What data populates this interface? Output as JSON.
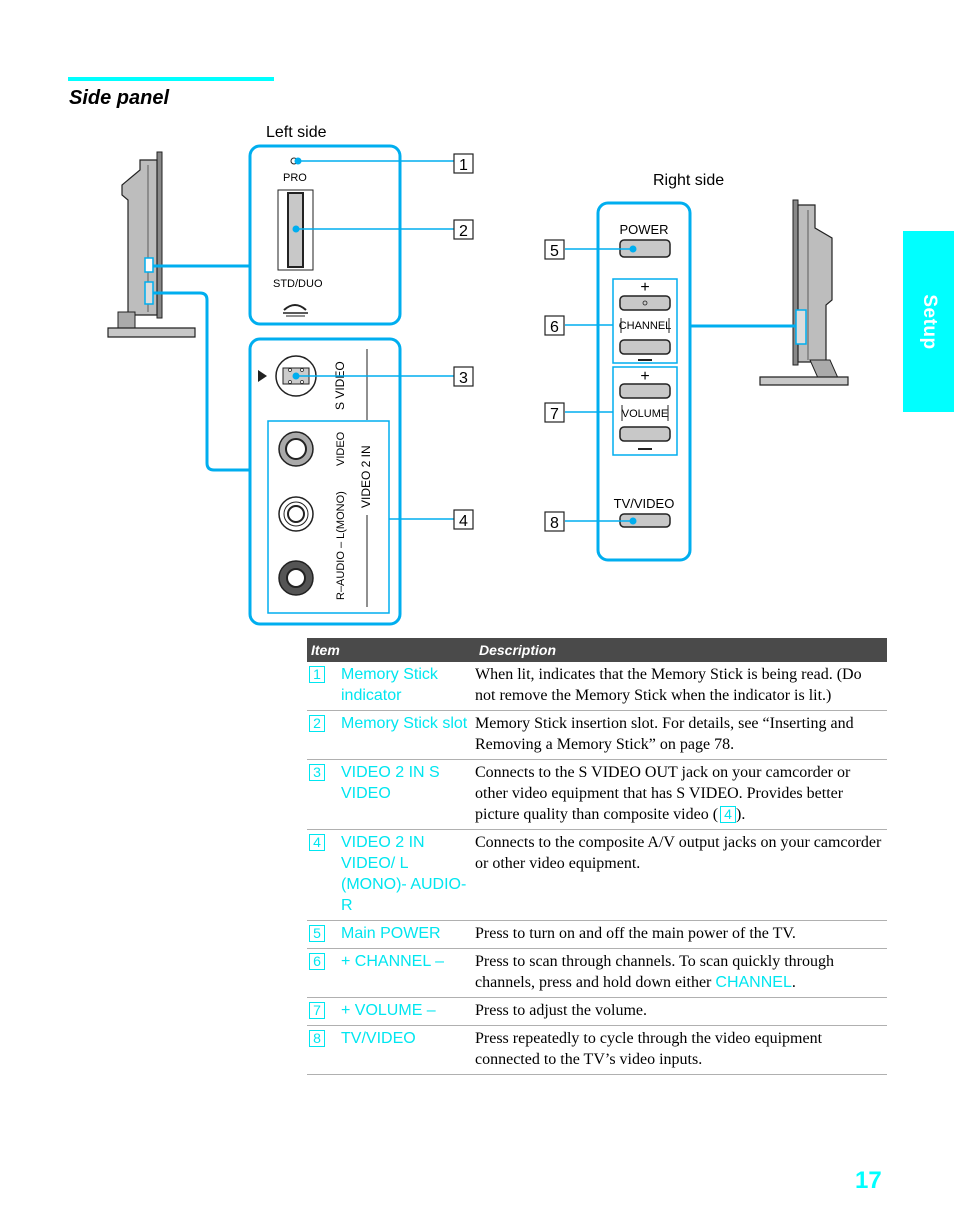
{
  "section_title": "Side panel",
  "side_tab": "Setup",
  "page_number": "17",
  "colors": {
    "accent": "#00ffff",
    "callout": "#00aeef",
    "link_text": "#00e6f0",
    "table_header_bg": "#4a4a4a"
  },
  "diagram": {
    "left_side_label": "Left side",
    "right_side_label": "Right side",
    "left_panel": {
      "pro_label": "PRO",
      "std_duo_label": "STD/DUO",
      "s_video_label": "S VIDEO",
      "video_label": "VIDEO",
      "audio_label": "R–AUDIO – L(MONO)",
      "video2in_label": "VIDEO 2 IN"
    },
    "right_panel": {
      "power_label": "POWER",
      "channel_label": "CHANNEL",
      "volume_label": "VOLUME",
      "tvvideo_label": "TV/VIDEO",
      "plus": "+",
      "minus": "–"
    },
    "callouts": [
      "1",
      "2",
      "3",
      "4",
      "5",
      "6",
      "7",
      "8"
    ]
  },
  "table": {
    "headers": {
      "item": "Item",
      "description": "Description"
    },
    "rows": [
      {
        "num": "1",
        "item": "Memory Stick indicator",
        "desc": "When lit, indicates that the Memory Stick is being read. (Do not remove the Memory Stick when the indicator is lit.)"
      },
      {
        "num": "2",
        "item": "Memory Stick slot",
        "desc": "Memory Stick insertion slot. For details, see “Inserting and Removing a Memory Stick” on page 78."
      },
      {
        "num": "3",
        "item": "VIDEO 2 IN S VIDEO",
        "desc_pre": "Connects to the S VIDEO OUT jack on your camcorder or other video equipment that has S VIDEO. Provides better picture quality than composite video (",
        "desc_ref": "4",
        "desc_post": ")."
      },
      {
        "num": "4",
        "item": "VIDEO 2 IN VIDEO/ L (MONO)- AUDIO-R",
        "desc": "Connects to the composite A/V output jacks on your camcorder or other video equipment."
      },
      {
        "num": "5",
        "item": "Main POWER",
        "desc": "Press to turn on and off the main power of the TV."
      },
      {
        "num": "6",
        "item": "+ CHANNEL –",
        "desc_pre": "Press to scan through channels. To scan quickly through channels, press and hold down either ",
        "desc_ref": "CHANNEL",
        "desc_post": "."
      },
      {
        "num": "7",
        "item": "+ VOLUME –",
        "desc": "Press to adjust the volume."
      },
      {
        "num": "8",
        "item": "TV/VIDEO",
        "desc": "Press repeatedly to cycle through the video equipment connected to the TV’s video inputs."
      }
    ]
  }
}
